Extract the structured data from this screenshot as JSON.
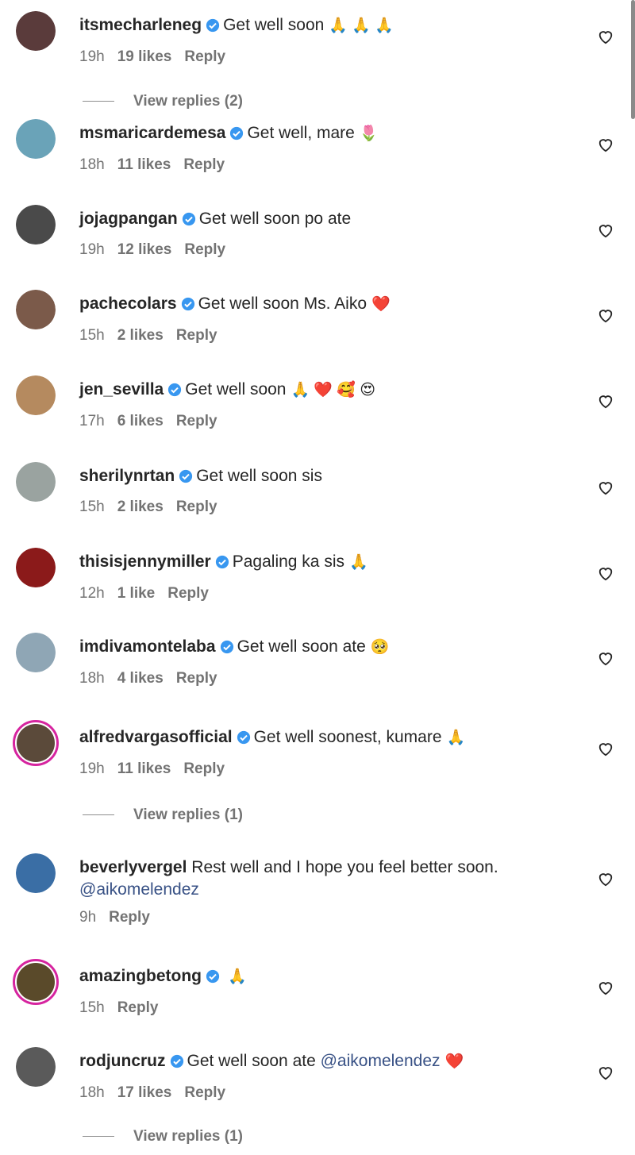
{
  "comments": [
    {
      "user": "itsmecharleneg",
      "verified": true,
      "text": "Get well soon",
      "emoji": "🙏 🙏 🙏",
      "time": "19h",
      "likes": "19 likes",
      "reply": "Reply",
      "avatar_color": "#5a3b3b",
      "ring": false
    },
    {
      "user": "msmaricardemesa",
      "verified": true,
      "text": "Get well, mare",
      "emoji": "🌷",
      "time": "18h",
      "likes": "11 likes",
      "reply": "Reply",
      "avatar_color": "#6aa3b8",
      "ring": false
    },
    {
      "user": "jojagpangan",
      "verified": true,
      "text": "Get well soon po ate",
      "emoji": "",
      "time": "19h",
      "likes": "12 likes",
      "reply": "Reply",
      "avatar_color": "#4a4a4a",
      "ring": false
    },
    {
      "user": "pachecolars",
      "verified": true,
      "text": "Get well soon Ms. Aiko",
      "emoji": "❤️",
      "time": "15h",
      "likes": "2 likes",
      "reply": "Reply",
      "avatar_color": "#7b5a4a",
      "ring": false
    },
    {
      "user": "jen_sevilla",
      "verified": true,
      "text": "Get well soon",
      "emoji": "🙏 ❤️ 🥰 😍",
      "time": "17h",
      "likes": "6 likes",
      "reply": "Reply",
      "avatar_color": "#b58a5f",
      "ring": false
    },
    {
      "user": "sherilynrtan",
      "verified": true,
      "text": "Get well soon sis",
      "emoji": "",
      "time": "15h",
      "likes": "2 likes",
      "reply": "Reply",
      "avatar_color": "#9aa3a0",
      "ring": false
    },
    {
      "user": "thisisjennymiller",
      "verified": true,
      "text": "Pagaling ka sis",
      "emoji": "🙏",
      "time": "12h",
      "likes": "1 like",
      "reply": "Reply",
      "avatar_color": "#8b1a1a",
      "ring": false
    },
    {
      "user": "imdivamontelaba",
      "verified": true,
      "text": "Get well soon ate",
      "emoji": "🥺",
      "time": "18h",
      "likes": "4 likes",
      "reply": "Reply",
      "avatar_color": "#8fa6b5",
      "ring": false
    },
    {
      "user": "alfredvargasofficial",
      "verified": true,
      "text": "Get well soonest, kumare",
      "emoji": "🙏",
      "time": "19h",
      "likes": "11 likes",
      "reply": "Reply",
      "avatar_color": "#5b4a3a",
      "ring": true
    },
    {
      "user": "beverlyvergel",
      "verified": false,
      "text": "Rest well and I hope you feel better soon.",
      "mention": "@aikomelendez",
      "emoji": "",
      "time": "9h",
      "likes": "",
      "reply": "Reply",
      "avatar_color": "#3a6ea5",
      "ring": false
    },
    {
      "user": "amazingbetong",
      "verified": true,
      "text": "",
      "emoji": "🙏",
      "time": "15h",
      "likes": "",
      "reply": "Reply",
      "avatar_color": "#5a4a2a",
      "ring": true
    },
    {
      "user": "rodjuncruz",
      "verified": true,
      "text": "Get well soon ate",
      "mention": "@aikomelendez",
      "emoji": "❤️",
      "time": "18h",
      "likes": "17 likes",
      "reply": "Reply",
      "avatar_color": "#5a5a5a",
      "ring": false
    }
  ],
  "view_replies": [
    "View replies (2)",
    "View replies (1)",
    "View replies (1)"
  ],
  "colors": {
    "verified": "#3897f0",
    "ring": "#d6249f",
    "meta": "#737373",
    "mention": "#385185"
  },
  "icons": {
    "like": "heart-outline-icon",
    "verified": "verified-badge-icon"
  }
}
